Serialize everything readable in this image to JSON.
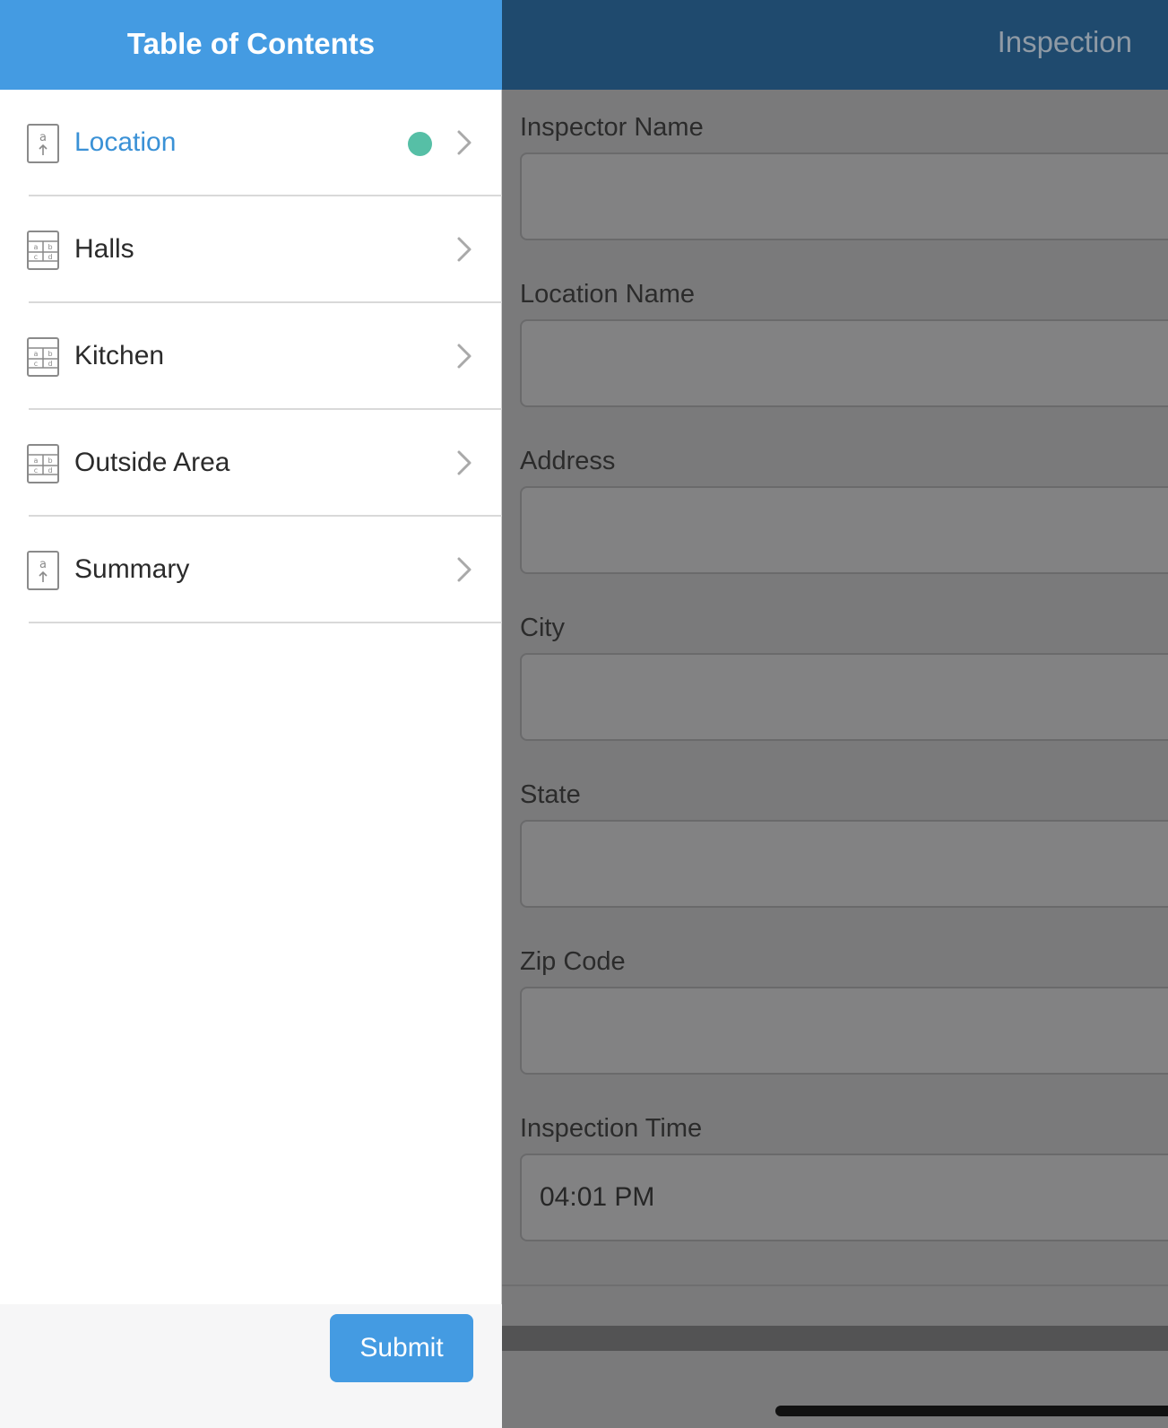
{
  "sidebar": {
    "title": "Table of Contents",
    "items": [
      {
        "label": "Location",
        "icon": "text-field-icon",
        "active": true,
        "status": "complete"
      },
      {
        "label": "Halls",
        "icon": "grid-table-icon",
        "active": false
      },
      {
        "label": "Kitchen",
        "icon": "grid-table-icon",
        "active": false
      },
      {
        "label": "Outside Area",
        "icon": "grid-table-icon",
        "active": false
      },
      {
        "label": "Summary",
        "icon": "text-field-icon",
        "active": false
      }
    ],
    "submit_label": "Submit"
  },
  "form": {
    "title": "Inspection",
    "fields": [
      {
        "label": "Inspector Name",
        "value": ""
      },
      {
        "label": "Location Name",
        "value": ""
      },
      {
        "label": "Address",
        "value": ""
      },
      {
        "label": "City",
        "value": ""
      },
      {
        "label": "State",
        "value": ""
      },
      {
        "label": "Zip Code",
        "value": ""
      },
      {
        "label": "Inspection Time",
        "value": "04:01 PM"
      }
    ]
  },
  "colors": {
    "accent": "#449be2",
    "header_dark": "#1f4a6e",
    "status_complete": "#56bfa6",
    "overlay": "#7a7a7b"
  }
}
